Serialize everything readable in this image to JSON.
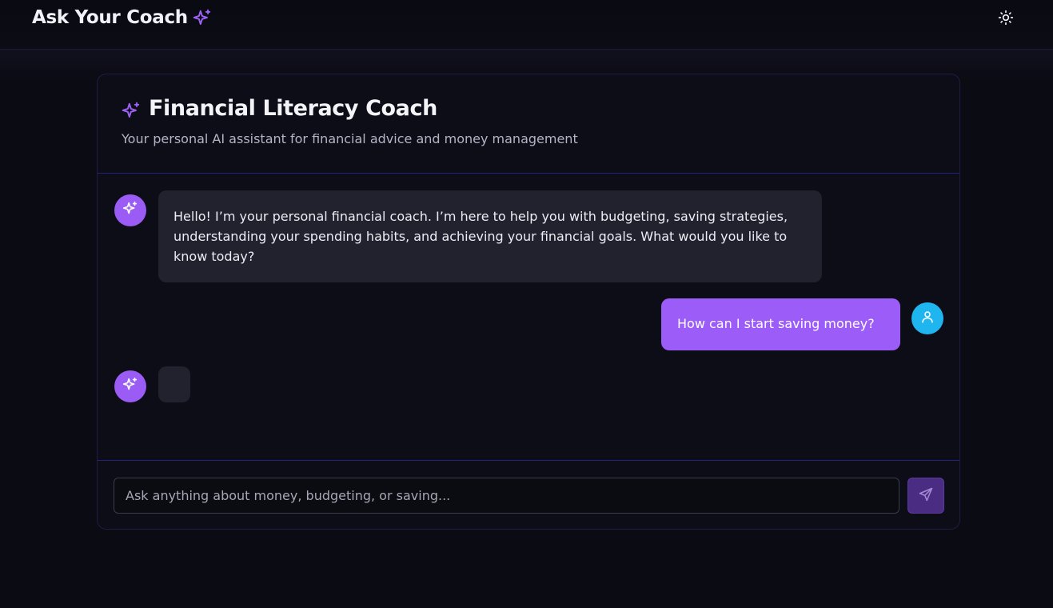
{
  "app": {
    "title": "Ask Your Coach",
    "title_icon": "sparkles-icon",
    "theme_toggle_icon": "sun-icon"
  },
  "coach_card": {
    "icon": "sparkles-icon",
    "title": "Financial Literacy Coach",
    "subtitle": "Your personal AI assistant for financial advice and money management"
  },
  "messages": [
    {
      "role": "assistant",
      "avatar_icon": "sparkles-icon",
      "text": "Hello! I’m your personal financial coach. I’m here to help you with budgeting, saving strategies, understanding your spending habits, and achieving your financial goals. What would you like to know today?"
    },
    {
      "role": "user",
      "avatar_icon": "user-icon",
      "text": "How can I start saving money?"
    },
    {
      "role": "assistant",
      "avatar_icon": "sparkles-icon",
      "text": "",
      "state": "loading"
    }
  ],
  "composer": {
    "placeholder": "Ask anything about money, budgeting, or saving...",
    "value": "",
    "send_icon": "send-icon"
  },
  "colors": {
    "background": "#0b0b13",
    "accent": "#9b5cf6",
    "user_avatar": "#1fb6f0",
    "card_border": "#232180",
    "send_button": "#4a2d83"
  }
}
